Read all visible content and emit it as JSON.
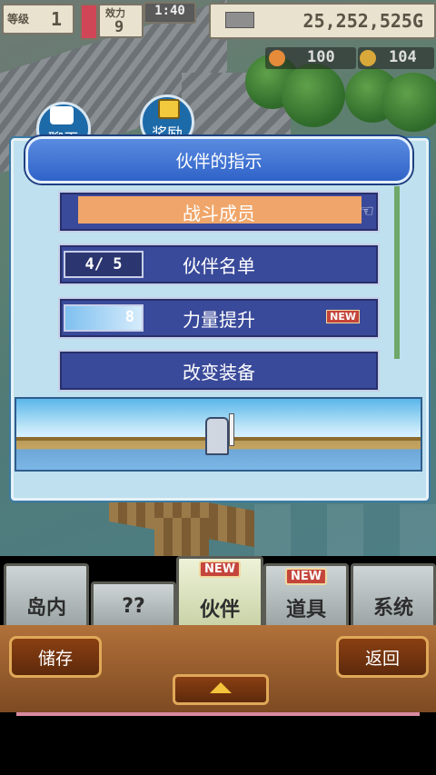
{
  "hud": {
    "level_label": "等级",
    "level_value": "1",
    "stamina_label": "效力",
    "stamina_value": "9",
    "clock": "1:40",
    "gold": "25,252,525G"
  },
  "resources": {
    "res1": "100",
    "res2": "104"
  },
  "bubbles": {
    "chat": "聊天",
    "reward": "奖励"
  },
  "dialog": {
    "title": "伙伴的指示",
    "items": [
      {
        "label": "战斗成员"
      },
      {
        "label": "伙伴名单",
        "badge": "4/ 5"
      },
      {
        "label": "力量提升",
        "badge": "8",
        "tag": "NEW"
      },
      {
        "label": "改变装备"
      }
    ]
  },
  "tabs": [
    {
      "label": "岛内"
    },
    {
      "label": "??"
    },
    {
      "label": "伙伴",
      "tag": "NEW"
    },
    {
      "label": "道具",
      "tag": "NEW"
    },
    {
      "label": "系统"
    }
  ],
  "bottom": {
    "save_label": "储存",
    "back_label": "返回"
  },
  "colors": {
    "dialog_title": "#2f63c8",
    "menu_button": "#3a4a9a",
    "selected_row": "#f0a66a",
    "new_tag": "#c4453b"
  }
}
